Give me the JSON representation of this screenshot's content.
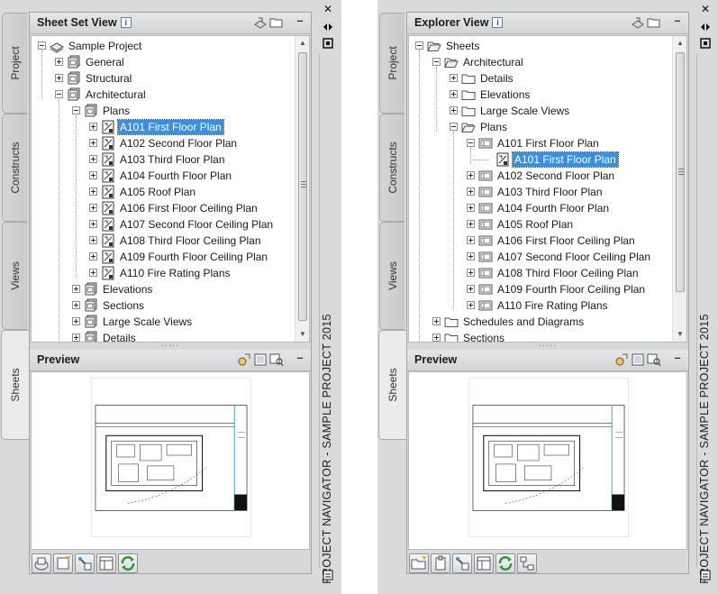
{
  "left_navigator": {
    "tabs": [
      "Project",
      "Constructs",
      "Views",
      "Sheets"
    ],
    "active_tab": "Sheets",
    "tree_header": {
      "title": "Sheet Set View",
      "info": "i",
      "minimize": "–"
    },
    "tree_items": [
      {
        "label": "Sample Project",
        "level": 0,
        "expander": "minus",
        "icon": "sheet-set-icon"
      },
      {
        "label": "General",
        "level": 1,
        "expander": "plus",
        "icon": "subset-icon"
      },
      {
        "label": "Structural",
        "level": 1,
        "expander": "plus",
        "icon": "subset-icon"
      },
      {
        "label": "Architectural",
        "level": 1,
        "expander": "minus",
        "icon": "subset-icon"
      },
      {
        "label": "Plans",
        "level": 2,
        "expander": "minus",
        "icon": "subset-icon"
      },
      {
        "label": "A101 First Floor Plan",
        "level": 3,
        "expander": "plus",
        "icon": "sheet-icon",
        "selected": true
      },
      {
        "label": "A102 Second Floor Plan",
        "level": 3,
        "expander": "plus",
        "icon": "sheet-icon"
      },
      {
        "label": "A103 Third Floor Plan",
        "level": 3,
        "expander": "plus",
        "icon": "sheet-icon"
      },
      {
        "label": "A104 Fourth Floor Plan",
        "level": 3,
        "expander": "plus",
        "icon": "sheet-icon"
      },
      {
        "label": "A105 Roof Plan",
        "level": 3,
        "expander": "plus",
        "icon": "sheet-icon"
      },
      {
        "label": "A106 First Floor Ceiling Plan",
        "level": 3,
        "expander": "plus",
        "icon": "sheet-icon"
      },
      {
        "label": "A107 Second Floor Ceiling Plan",
        "level": 3,
        "expander": "plus",
        "icon": "sheet-icon"
      },
      {
        "label": "A108 Third Floor Ceiling Plan",
        "level": 3,
        "expander": "plus",
        "icon": "sheet-icon"
      },
      {
        "label": "A109 Fourth Floor Ceiling Plan",
        "level": 3,
        "expander": "plus",
        "icon": "sheet-icon"
      },
      {
        "label": "A110 Fire Rating Plans",
        "level": 3,
        "expander": "plus",
        "icon": "sheet-icon"
      },
      {
        "label": "Elevations",
        "level": 2,
        "expander": "plus",
        "icon": "subset-icon"
      },
      {
        "label": "Sections",
        "level": 2,
        "expander": "plus",
        "icon": "subset-icon"
      },
      {
        "label": "Large Scale Views",
        "level": 2,
        "expander": "plus",
        "icon": "subset-icon"
      },
      {
        "label": "Details",
        "level": 2,
        "expander": "plus",
        "icon": "subset-icon"
      }
    ],
    "preview_header": {
      "title": "Preview",
      "minimize": "–"
    },
    "footer_buttons": [
      "publish-icon",
      "new-sheet-icon",
      "sheet-properties-icon",
      "sheet-list-icon",
      "refresh-icon"
    ],
    "strip_title": "PROJECT NAVIGATOR - SAMPLE PROJECT 2015",
    "close": "✕"
  },
  "right_navigator": {
    "tabs": [
      "Project",
      "Constructs",
      "Views",
      "Sheets"
    ],
    "active_tab": "Sheets",
    "tree_header": {
      "title": "Explorer View",
      "info": "i",
      "minimize": "–"
    },
    "tree_items": [
      {
        "label": "Sheets",
        "level": 0,
        "expander": "minus",
        "icon": "folder-open-icon"
      },
      {
        "label": "Architectural",
        "level": 1,
        "expander": "minus",
        "icon": "folder-open-icon"
      },
      {
        "label": "Details",
        "level": 2,
        "expander": "plus",
        "icon": "folder-icon"
      },
      {
        "label": "Elevations",
        "level": 2,
        "expander": "plus",
        "icon": "folder-icon"
      },
      {
        "label": "Large Scale Views",
        "level": 2,
        "expander": "plus",
        "icon": "folder-icon"
      },
      {
        "label": "Plans",
        "level": 2,
        "expander": "minus",
        "icon": "folder-open-icon"
      },
      {
        "label": "A101 First Floor Plan",
        "level": 3,
        "expander": "minus",
        "icon": "drawing-file-icon"
      },
      {
        "label": "A101 First Floor Plan",
        "level": 4,
        "expander": "none",
        "icon": "sheet-icon",
        "selected": true
      },
      {
        "label": "A102 Second Floor Plan",
        "level": 3,
        "expander": "plus",
        "icon": "drawing-file-icon"
      },
      {
        "label": "A103 Third Floor Plan",
        "level": 3,
        "expander": "plus",
        "icon": "drawing-file-icon"
      },
      {
        "label": "A104 Fourth Floor Plan",
        "level": 3,
        "expander": "plus",
        "icon": "drawing-file-icon"
      },
      {
        "label": "A105 Roof Plan",
        "level": 3,
        "expander": "plus",
        "icon": "drawing-file-icon"
      },
      {
        "label": "A106 First Floor Ceiling Plan",
        "level": 3,
        "expander": "plus",
        "icon": "drawing-file-icon"
      },
      {
        "label": "A107 Second Floor Ceiling Plan",
        "level": 3,
        "expander": "plus",
        "icon": "drawing-file-icon"
      },
      {
        "label": "A108 Third Floor Ceiling Plan",
        "level": 3,
        "expander": "plus",
        "icon": "drawing-file-icon"
      },
      {
        "label": "A109 Fourth Floor Ceiling Plan",
        "level": 3,
        "expander": "plus",
        "icon": "drawing-file-icon"
      },
      {
        "label": "A110 Fire Rating Plans",
        "level": 3,
        "expander": "plus",
        "icon": "drawing-file-icon"
      },
      {
        "label": "Schedules and Diagrams",
        "level": 1,
        "expander": "plus",
        "icon": "folder-icon"
      },
      {
        "label": "Sections",
        "level": 1,
        "expander": "plus",
        "icon": "folder-icon"
      }
    ],
    "preview_header": {
      "title": "Preview",
      "minimize": "–"
    },
    "footer_buttons": [
      "new-folder-icon",
      "clipboard-icon",
      "sheet-properties-icon",
      "sheet-list-icon",
      "refresh-icon",
      "repath-icon"
    ],
    "strip_title": "PROJECT NAVIGATOR - SAMPLE PROJECT 2015",
    "close": "✕"
  },
  "colors": {
    "selection": "#3a8fe0",
    "panel": "#d9dadc",
    "refresh_green": "#2e9a2e"
  }
}
